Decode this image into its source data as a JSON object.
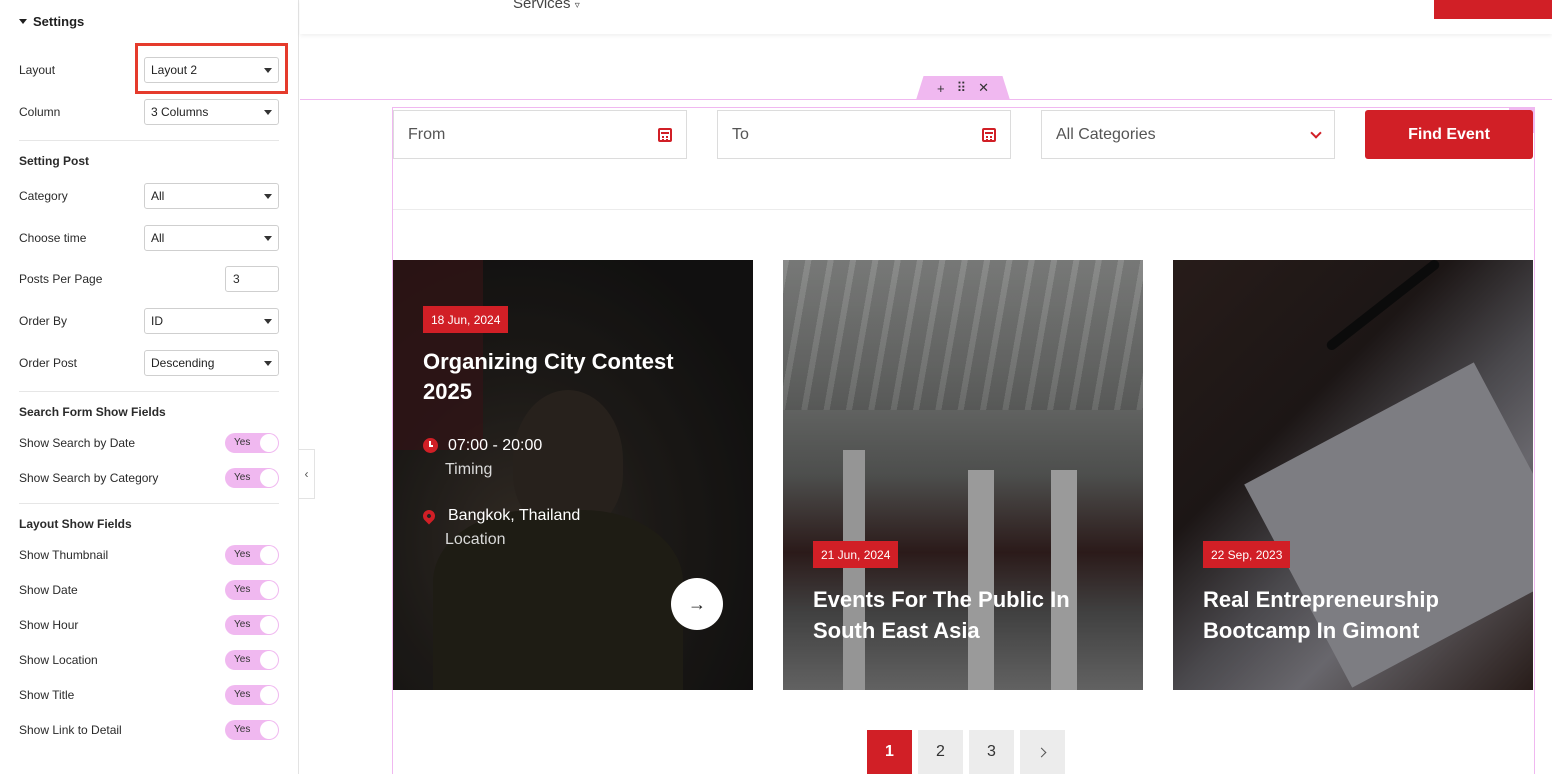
{
  "panel": {
    "section_title": "Settings",
    "layout": {
      "label": "Layout",
      "value": "Layout 2"
    },
    "column": {
      "label": "Column",
      "value": "3 Columns"
    },
    "setting_post": {
      "heading": "Setting Post",
      "category": {
        "label": "Category",
        "value": "All"
      },
      "choose_time": {
        "label": "Choose time",
        "value": "All"
      },
      "posts_per_page": {
        "label": "Posts Per Page",
        "value": "3"
      },
      "order_by": {
        "label": "Order By",
        "value": "ID"
      },
      "order_post": {
        "label": "Order Post",
        "value": "Descending"
      }
    },
    "search_form": {
      "heading": "Search Form Show Fields",
      "items": [
        {
          "label": "Show Search by Date",
          "value": "Yes"
        },
        {
          "label": "Show Search by Category",
          "value": "Yes"
        }
      ]
    },
    "layout_fields": {
      "heading": "Layout Show Fields",
      "items": [
        {
          "label": "Show Thumbnail",
          "value": "Yes"
        },
        {
          "label": "Show Date",
          "value": "Yes"
        },
        {
          "label": "Show Hour",
          "value": "Yes"
        },
        {
          "label": "Show Location",
          "value": "Yes"
        },
        {
          "label": "Show Title",
          "value": "Yes"
        },
        {
          "label": "Show Link to Detail",
          "value": "Yes"
        }
      ]
    },
    "collapse_glyph": "‹"
  },
  "header": {
    "menu_item": "Services"
  },
  "handle": {
    "add": "+",
    "move": "⠿",
    "close": "✕"
  },
  "search": {
    "from_placeholder": "From",
    "to_placeholder": "To",
    "category_value": "All Categories",
    "find_label": "Find Event"
  },
  "cards": [
    {
      "date": "18 Jun, 2024",
      "title_line1": "Organizing City Contest",
      "title_line2": "2025",
      "time": "07:00 - 20:00",
      "time_label": "Timing",
      "location": "Bangkok, Thailand",
      "location_label": "Location",
      "arrow": "→"
    },
    {
      "date": "21 Jun, 2024",
      "title_line1": "Events For The Public In",
      "title_line2": "South East Asia"
    },
    {
      "date": "22 Sep, 2023",
      "title_line1": "Real Entrepreneurship",
      "title_line2": "Bootcamp In Gimont"
    }
  ],
  "pagination": {
    "pages": [
      "1",
      "2",
      "3"
    ],
    "current": "1"
  },
  "colors": {
    "accent": "#d11f26",
    "editor_pink": "#f0b8f0",
    "highlight": "#e53b2c"
  },
  "icons": [
    "calendar-icon",
    "chevron-down-icon",
    "clock-icon",
    "map-pin-icon",
    "arrow-right-icon",
    "pencil-icon",
    "chevron-right-icon"
  ]
}
